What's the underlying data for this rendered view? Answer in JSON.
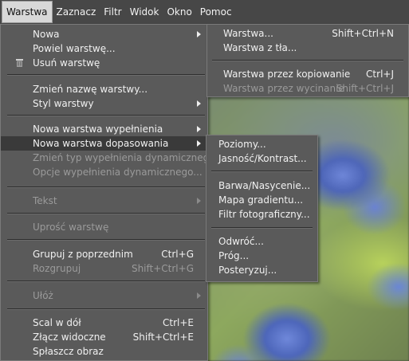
{
  "menubar": {
    "items": [
      "Warstwa",
      "Zaznacz",
      "Filtr",
      "Widok",
      "Okno",
      "Pomoc"
    ]
  },
  "main_menu": {
    "nowa": "Nowa",
    "powiel": "Powiel warstwę...",
    "usun": "Usuń warstwę",
    "zmien_nazwe": "Zmień nazwę warstwy...",
    "styl": "Styl warstwy",
    "nowa_wypelnienia": "Nowa warstwa wypełnienia",
    "nowa_dopasowania": "Nowa warstwa dopasowania",
    "zmien_typ": "Zmień typ wypełnienia dynamicznego",
    "opcje_wypelnienia": "Opcje wypełnienia dynamicznego...",
    "tekst": "Tekst",
    "uprosc": "Uprość warstwę",
    "grupuj": "Grupuj z poprzednim",
    "grupuj_sc": "Ctrl+G",
    "rozgrupuj": "Rozgrupuj",
    "rozgrupuj_sc": "Shift+Ctrl+G",
    "uloz": "Ułóż",
    "scal_w_dol": "Scal w dół",
    "scal_w_dol_sc": "Ctrl+E",
    "zlacz": "Złącz widoczne",
    "zlacz_sc": "Shift+Ctrl+E",
    "splaszcz": "Spłaszcz obraz"
  },
  "submenu_nowa": {
    "warstwa": "Warstwa...",
    "warstwa_sc": "Shift+Ctrl+N",
    "z_tla": "Warstwa z tła...",
    "przez_kopiowanie": "Warstwa przez kopiowanie",
    "przez_kopiowanie_sc": "Ctrl+J",
    "przez_wycinanie": "Warstwa przez wycinanie",
    "przez_wycinanie_sc": "Shift+Ctrl+J"
  },
  "submenu_dopasowania": {
    "poziomy": "Poziomy...",
    "jasnosc": "Jasność/Kontrast...",
    "barwa": "Barwa/Nasycenie...",
    "mapa": "Mapa gradientu...",
    "filtr": "Filtr fotograficzny...",
    "odwroc": "Odwróć...",
    "prog": "Próg...",
    "posteryzuj": "Posteryzuj..."
  },
  "colors": {
    "menu_bg": "#5a5a5a",
    "highlight": "#3a3a3a",
    "text": "#f0f0f0",
    "disabled_text": "#9a9a9a"
  }
}
